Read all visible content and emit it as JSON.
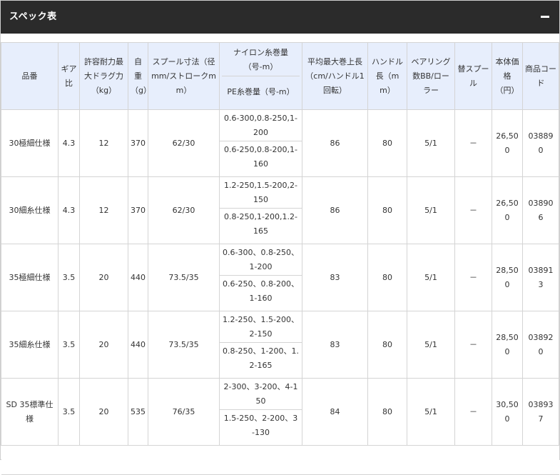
{
  "title": "スペック表",
  "headers": {
    "model": "品番",
    "gear": "ギア比",
    "drag": "許容耐力最大ドラグ力（kg）",
    "weight": "自重（g）",
    "spool": "スプール寸法（径mm/ストロークmm）",
    "line_nylon": "ナイロン糸巻量（号-m）",
    "line_pe": "PE糸巻量（号-m）",
    "retrieve": "平均最大巻上長（cm/ハンドル1回転）",
    "handle": "ハンドル長（mm）",
    "bearing": "ベアリング数BB/ローラー",
    "spare": "替スプール",
    "price": "本体価格（円）",
    "code": "商品コード"
  },
  "rows": [
    {
      "model": "30極細仕様",
      "gear": "4.3",
      "drag": "12",
      "weight": "370",
      "spool": "62/30",
      "nylon": "0.6-300,0.8-250,1-200",
      "pe": "0.6-250,0.8-200,1-160",
      "retrieve": "86",
      "handle": "80",
      "bearing": "5/1",
      "spare": "－",
      "price": "26,500",
      "code": "03889 0"
    },
    {
      "model": "30細糸仕様",
      "gear": "4.3",
      "drag": "12",
      "weight": "370",
      "spool": "62/30",
      "nylon": "1.2-250,1.5-200,2-150",
      "pe": "0.8-250,1-200,1.2-165",
      "retrieve": "86",
      "handle": "80",
      "bearing": "5/1",
      "spare": "－",
      "price": "26,500",
      "code": "03890 6"
    },
    {
      "model": "35極細仕様",
      "gear": "3.5",
      "drag": "20",
      "weight": "440",
      "spool": "73.5/35",
      "nylon": "0.6-300、0.8-250、1-200",
      "pe": "0.6-250、0.8-200、1-160",
      "retrieve": "83",
      "handle": "80",
      "bearing": "5/1",
      "spare": "－",
      "price": "28,500",
      "code": "03891 3"
    },
    {
      "model": "35細糸仕様",
      "gear": "3.5",
      "drag": "20",
      "weight": "440",
      "spool": "73.5/35",
      "nylon": "1.2-250、1.5-200、2-150",
      "pe": "0.8-250、1-200、1.2-165",
      "retrieve": "83",
      "handle": "80",
      "bearing": "5/1",
      "spare": "－",
      "price": "28,500",
      "code": "03892 0"
    },
    {
      "model": "SD 35標準仕様",
      "gear": "3.5",
      "drag": "20",
      "weight": "535",
      "spool": "76/35",
      "nylon": "2-300、3-200、4-150",
      "pe": "1.5-250、2-200、3-130",
      "retrieve": "84",
      "handle": "80",
      "bearing": "5/1",
      "spare": "－",
      "price": "30,500",
      "code": "03893 7"
    }
  ]
}
